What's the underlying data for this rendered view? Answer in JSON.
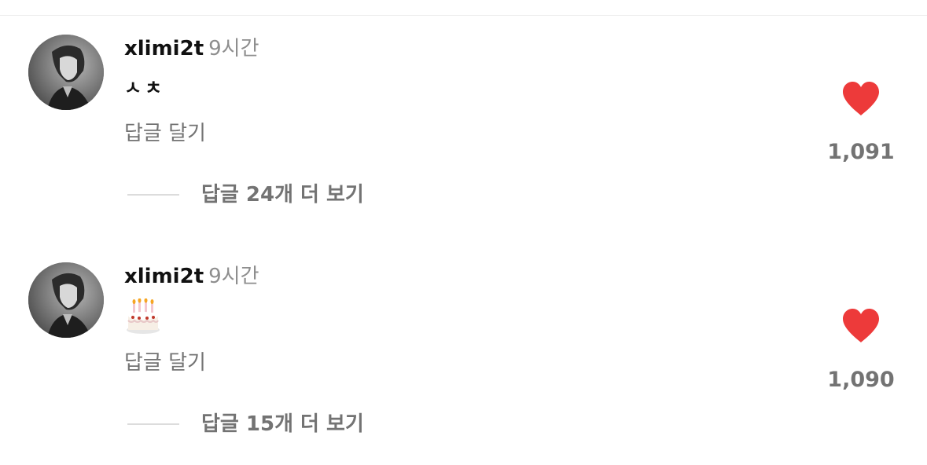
{
  "colors": {
    "heart": "#ed3a3a",
    "muted_text": "#737373",
    "time_text": "#8e8e8e",
    "divider": "#dcdcdc"
  },
  "comments": [
    {
      "username": "xlimi2t",
      "time": "9시간",
      "text": "ㅅㅊ",
      "reply_label": "답글 달기",
      "view_replies_label": "답글 24개 더 보기",
      "like_count": "1,091",
      "liked": true,
      "heart_icon": "heart-filled-icon"
    },
    {
      "username": "xlimi2t",
      "time": "9시간",
      "emoji_icon": "birthday-cake-icon",
      "reply_label": "답글 달기",
      "view_replies_label": "답글 15개 더 보기",
      "like_count": "1,090",
      "liked": true,
      "heart_icon": "heart-filled-icon"
    }
  ]
}
